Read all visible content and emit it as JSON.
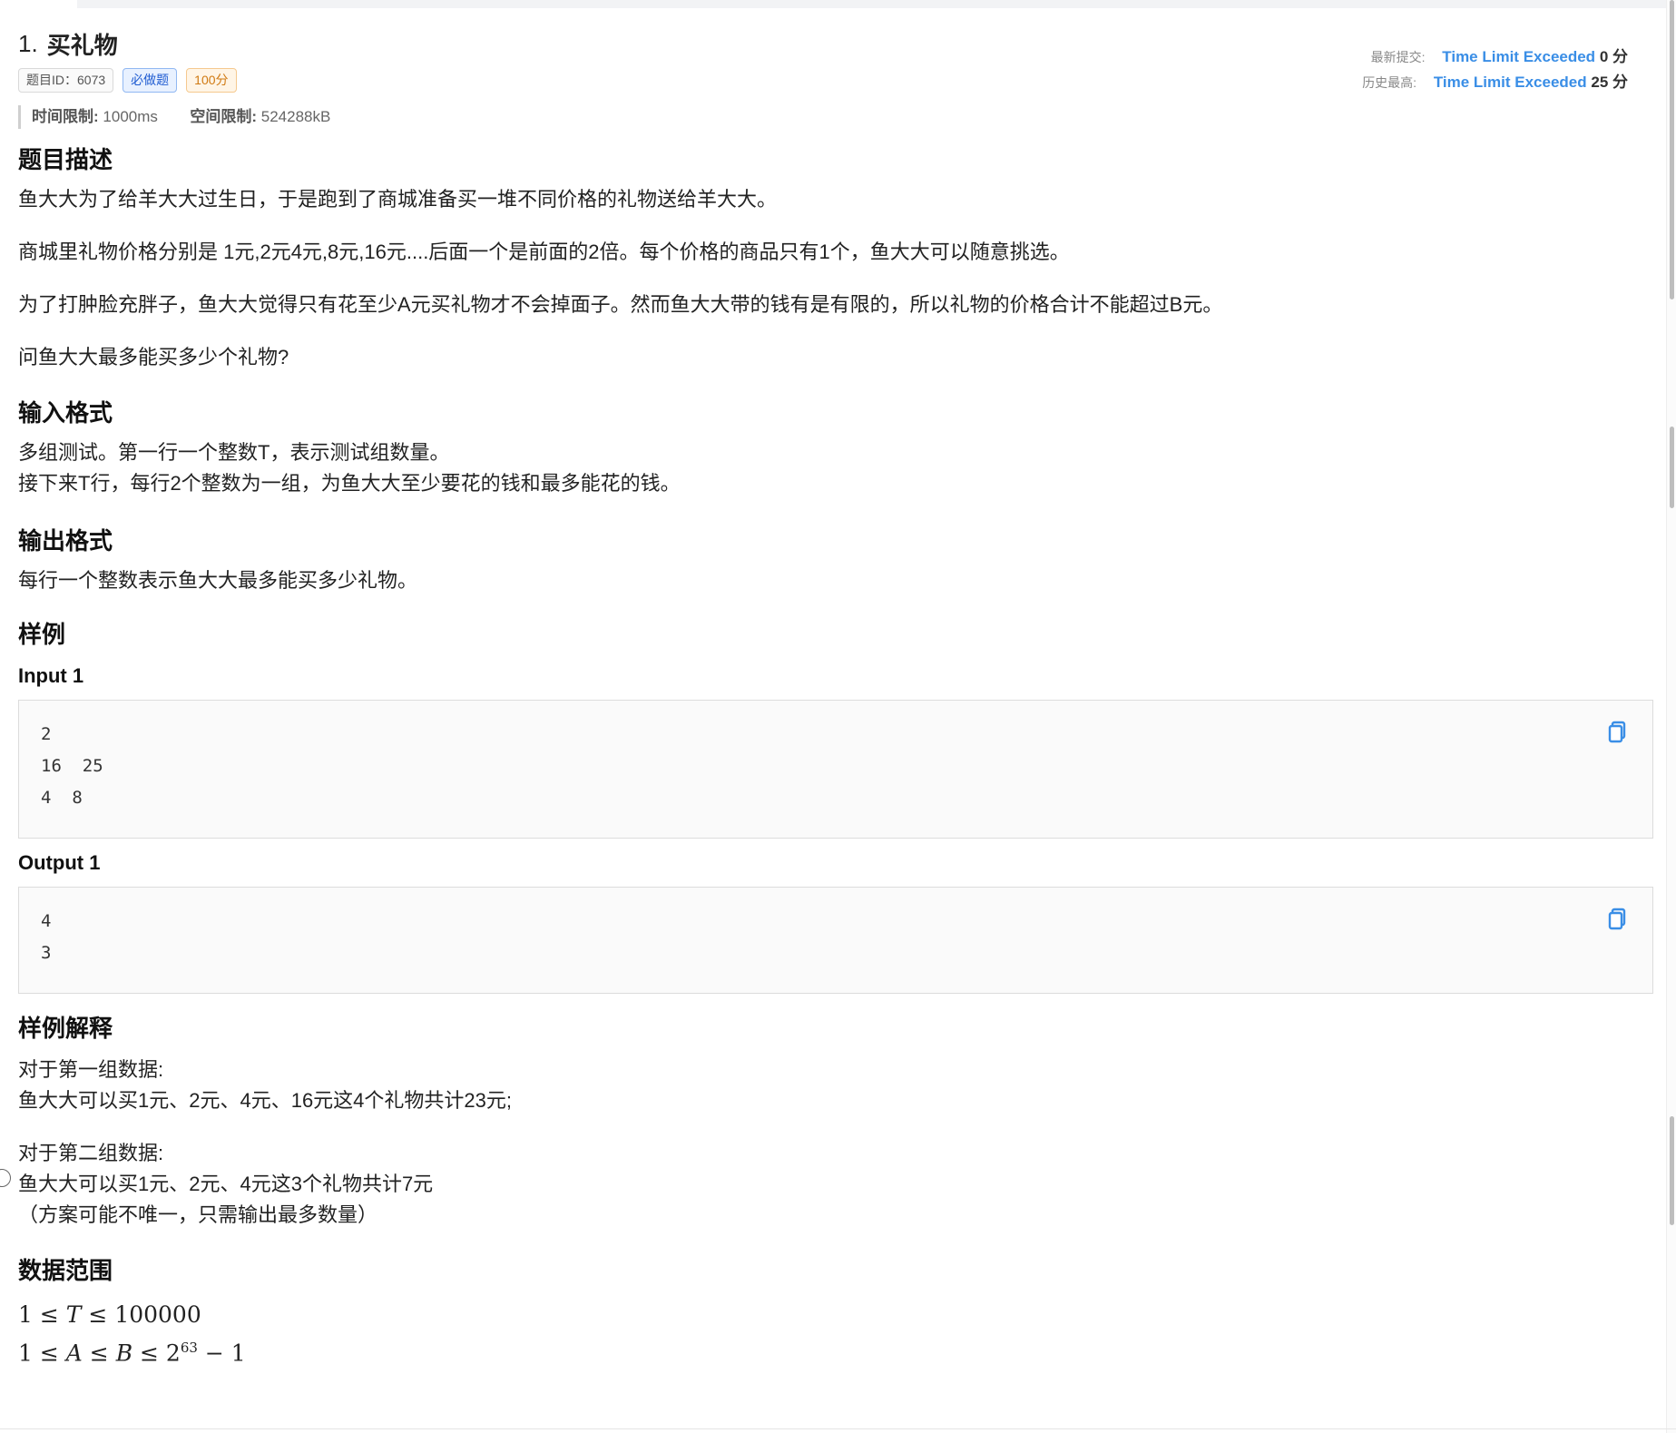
{
  "problem": {
    "number": "1.",
    "title": "买礼物",
    "tags": [
      "题目ID：6073",
      "必做题",
      "100分"
    ],
    "limits": {
      "time_label": "时间限制:",
      "time_value": "1000ms",
      "space_label": "空间限制:",
      "space_value": "524288kB"
    }
  },
  "status": {
    "latest_label": "最新提交:",
    "latest_verdict": "Time Limit Exceeded",
    "latest_score": "0 分",
    "best_label": "历史最高:",
    "best_verdict": "Time Limit Exceeded",
    "best_score": "25 分"
  },
  "sections": {
    "description_title": "题目描述",
    "description": [
      "鱼大大为了给羊大大过生日，于是跑到了商城准备买一堆不同价格的礼物送给羊大大。",
      "商城里礼物价格分别是 1元,2元4元,8元,16元....后面一个是前面的2倍。每个价格的商品只有1个，鱼大大可以随意挑选。",
      "为了打肿脸充胖子，鱼大大觉得只有花至少A元买礼物才不会掉面子。然而鱼大大带的钱有是有限的，所以礼物的价格合计不能超过B元。",
      "问鱼大大最多能买多少个礼物?"
    ],
    "input_title": "输入格式",
    "input_lines": [
      "多组测试。第一行一个整数T，表示测试组数量。",
      "接下来T行，每行2个整数为一组，为鱼大大至少要花的钱和最多能花的钱。"
    ],
    "output_title": "输出格式",
    "output_text": "每行一个整数表示鱼大大最多能买多少礼物。",
    "samples_title": "样例",
    "input1_label": "Input 1",
    "input1_lines": [
      "2",
      "16  25",
      "4  8"
    ],
    "output1_label": "Output 1",
    "output1_lines": [
      "4",
      "3"
    ],
    "explain_title": "样例解释",
    "explain_group1": [
      "对于第一组数据:",
      "鱼大大可以买1元、2元、4元、16元这4个礼物共计23元;"
    ],
    "explain_group2": [
      "对于第二组数据:",
      "鱼大大可以买1元、2元、4元这3个礼物共计7元",
      "（方案可能不唯一，只需输出最多数量）"
    ],
    "range_title": "数据范围",
    "range_line1": {
      "a": "1",
      "op1": "≤",
      "var": "T",
      "op2": "≤",
      "b": "100000"
    },
    "range_line2": {
      "a": "1",
      "op1": "≤",
      "var1": "A",
      "op2": "≤",
      "var2": "B",
      "op3": "≤",
      "base": "2",
      "exp": "63",
      "minus": "−",
      "c": "1"
    }
  },
  "icons": {
    "copy": "copy-icon"
  },
  "colors": {
    "accent": "#3a8ee6",
    "tag_blue": "#1e5bd1",
    "tag_orange": "#d07a12"
  }
}
